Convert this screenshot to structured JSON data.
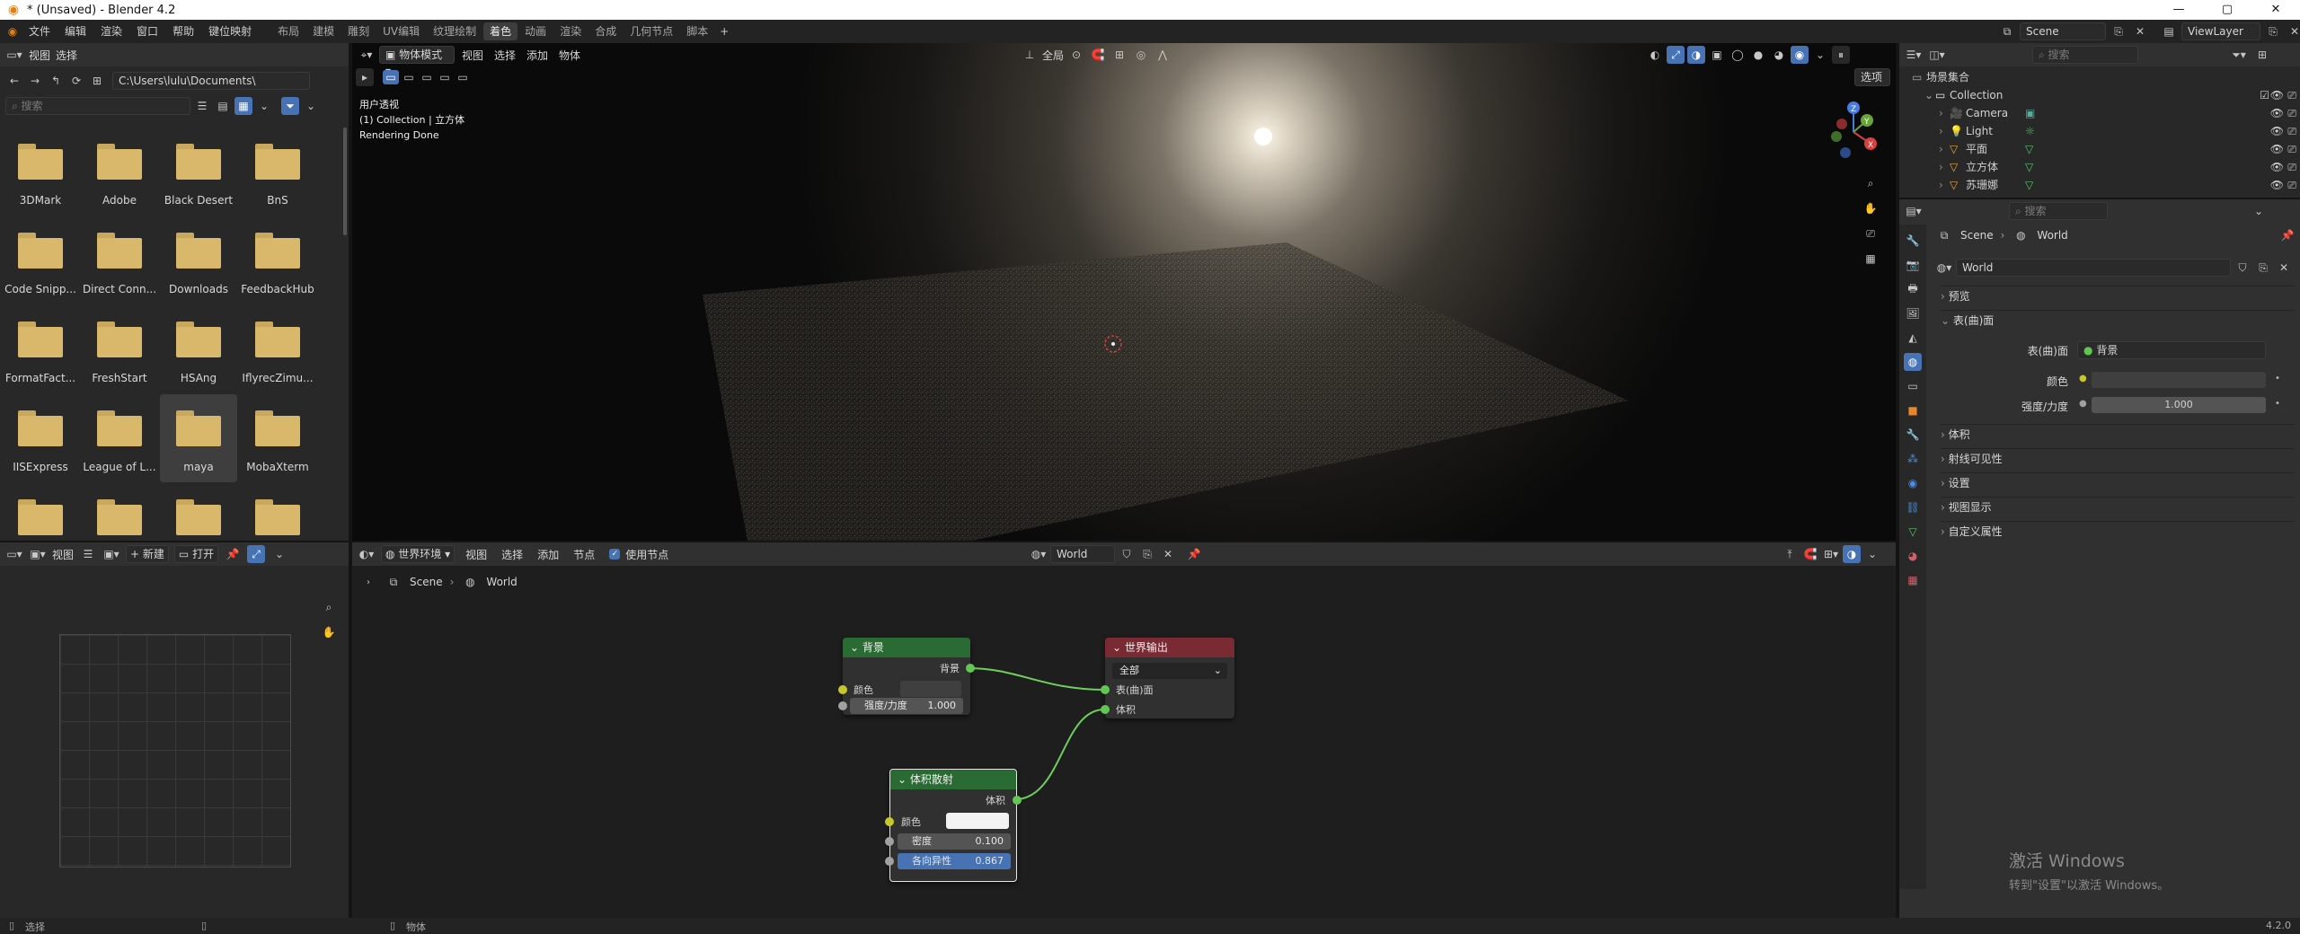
{
  "titlebar": {
    "title": "* (Unsaved) - Blender 4.2"
  },
  "menu": [
    "文件",
    "编辑",
    "渲染",
    "窗口",
    "帮助",
    "键位映射"
  ],
  "workspaces": [
    "布局",
    "建模",
    "雕刻",
    "UV编辑",
    "纹理绘制",
    "着色",
    "动画",
    "渲染",
    "合成",
    "几何节点",
    "脚本"
  ],
  "workspace_active": "着色",
  "topright": {
    "scene": "Scene",
    "viewlayer": "ViewLayer"
  },
  "filebrowser": {
    "menu": [
      "视图",
      "选择"
    ],
    "path": "C:\\Users\\lulu\\Documents\\",
    "search_placeholder": "搜索",
    "folders": [
      "3DMark",
      "Adobe",
      "Black Desert",
      "BnS",
      "Code Snipp...",
      "Direct Conn...",
      "Downloads",
      "FeedbackHub",
      "FormatFact...",
      "FreshStart",
      "HSAng",
      "IflyrecZimu...",
      "IISExpress",
      "League of L...",
      "maya",
      "MobaXterm",
      "",
      "",
      "",
      ""
    ],
    "selected": "maya"
  },
  "viewport": {
    "mode": "物体模式",
    "menu": [
      "视图",
      "选择",
      "添加",
      "物体"
    ],
    "transform": "全局",
    "options": "选项",
    "overlay_lines": [
      "用户透视",
      "(1) Collection | 立方体",
      "Rendering Done"
    ]
  },
  "imageeditor": {
    "view": "视图",
    "new": "新建",
    "open": "打开"
  },
  "nodeeditor": {
    "type": "世界环境",
    "menu": [
      "视图",
      "选择",
      "添加",
      "节点"
    ],
    "use_nodes": "使用节点",
    "datablock": "World",
    "breadcrumb": [
      "Scene",
      "World"
    ],
    "nodes": {
      "background": {
        "title": "背景",
        "out": "背景",
        "color": "颜色",
        "strength_label": "强度/力度",
        "strength": "1.000"
      },
      "output": {
        "title": "世界输出",
        "target": "全部",
        "surface": "表(曲)面",
        "volume": "体积"
      },
      "scatter": {
        "title": "体积散射",
        "out": "体积",
        "color": "颜色",
        "density_label": "密度",
        "density": "0.100",
        "aniso_label": "各向异性",
        "aniso": "0.867"
      }
    }
  },
  "outliner": {
    "search_placeholder": "搜索",
    "root": "场景集合",
    "collection": "Collection",
    "items": [
      "Camera",
      "Light",
      "平面",
      "立方体",
      "苏珊娜"
    ]
  },
  "properties": {
    "search_placeholder": "搜索",
    "breadcrumb": [
      "Scene",
      "World"
    ],
    "datablock": "World",
    "sections": {
      "preview": "预览",
      "surface": "表(曲)面",
      "volume": "体积",
      "ray": "射线可见性",
      "settings": "设置",
      "viewport": "视图显示",
      "custom": "自定义属性"
    },
    "surface_label": "表(曲)面",
    "surface_value": "背景",
    "color_label": "颜色",
    "strength_label": "强度/力度",
    "strength_value": "1.000"
  },
  "watermark": {
    "line1": "激活 Windows",
    "line2": "转到\"设置\"以激活 Windows。"
  },
  "statusbar": {
    "left": "选择",
    "mid": "物体",
    "version": "4.2.0"
  },
  "colors": {
    "accent": "#4772b3",
    "node_green": "#2a6b34",
    "node_red": "#7a2a33",
    "folder": "#d9b86c"
  }
}
